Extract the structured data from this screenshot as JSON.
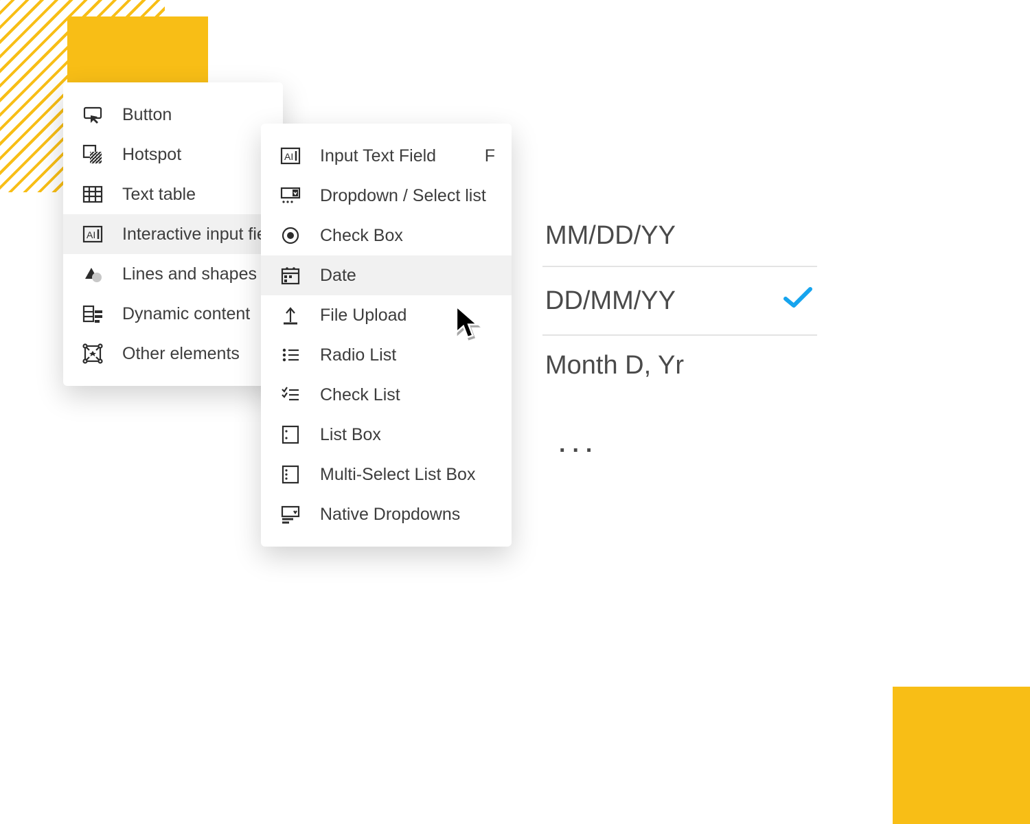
{
  "menu_outer": {
    "items": [
      {
        "label": "Button",
        "icon": "button-icon"
      },
      {
        "label": "Hotspot",
        "icon": "hotspot-icon"
      },
      {
        "label": "Text table",
        "icon": "texttable-icon"
      },
      {
        "label": "Interactive input fields",
        "icon": "ai-input-icon",
        "hover": true
      },
      {
        "label": "Lines and shapes",
        "icon": "shapes-icon"
      },
      {
        "label": "Dynamic content",
        "icon": "dynamic-icon"
      },
      {
        "label": "Other elements",
        "icon": "other-icon"
      }
    ]
  },
  "menu_inner": {
    "items": [
      {
        "label": "Input Text Field",
        "icon": "ai-input-icon",
        "shortcut": "F"
      },
      {
        "label": "Dropdown / Select list",
        "icon": "dropdown-icon"
      },
      {
        "label": "Check Box",
        "icon": "checkbox-icon"
      },
      {
        "label": "Date",
        "icon": "date-icon",
        "hover": true
      },
      {
        "label": "File Upload",
        "icon": "upload-icon"
      },
      {
        "label": "Radio List",
        "icon": "radiolist-icon"
      },
      {
        "label": "Check List",
        "icon": "checklist-icon"
      },
      {
        "label": "List Box",
        "icon": "listbox-icon"
      },
      {
        "label": "Multi-Select List Box",
        "icon": "multiselect-icon"
      },
      {
        "label": "Native Dropdowns",
        "icon": "nativedrop-icon"
      }
    ]
  },
  "date_formats": {
    "options": [
      {
        "label": "MM/DD/YY",
        "selected": false
      },
      {
        "label": "DD/MM/YY",
        "selected": true
      },
      {
        "label": "Month D, Yr",
        "selected": false
      }
    ],
    "more": "..."
  },
  "accent_color": "#f8be16",
  "check_color": "#16a4ee"
}
